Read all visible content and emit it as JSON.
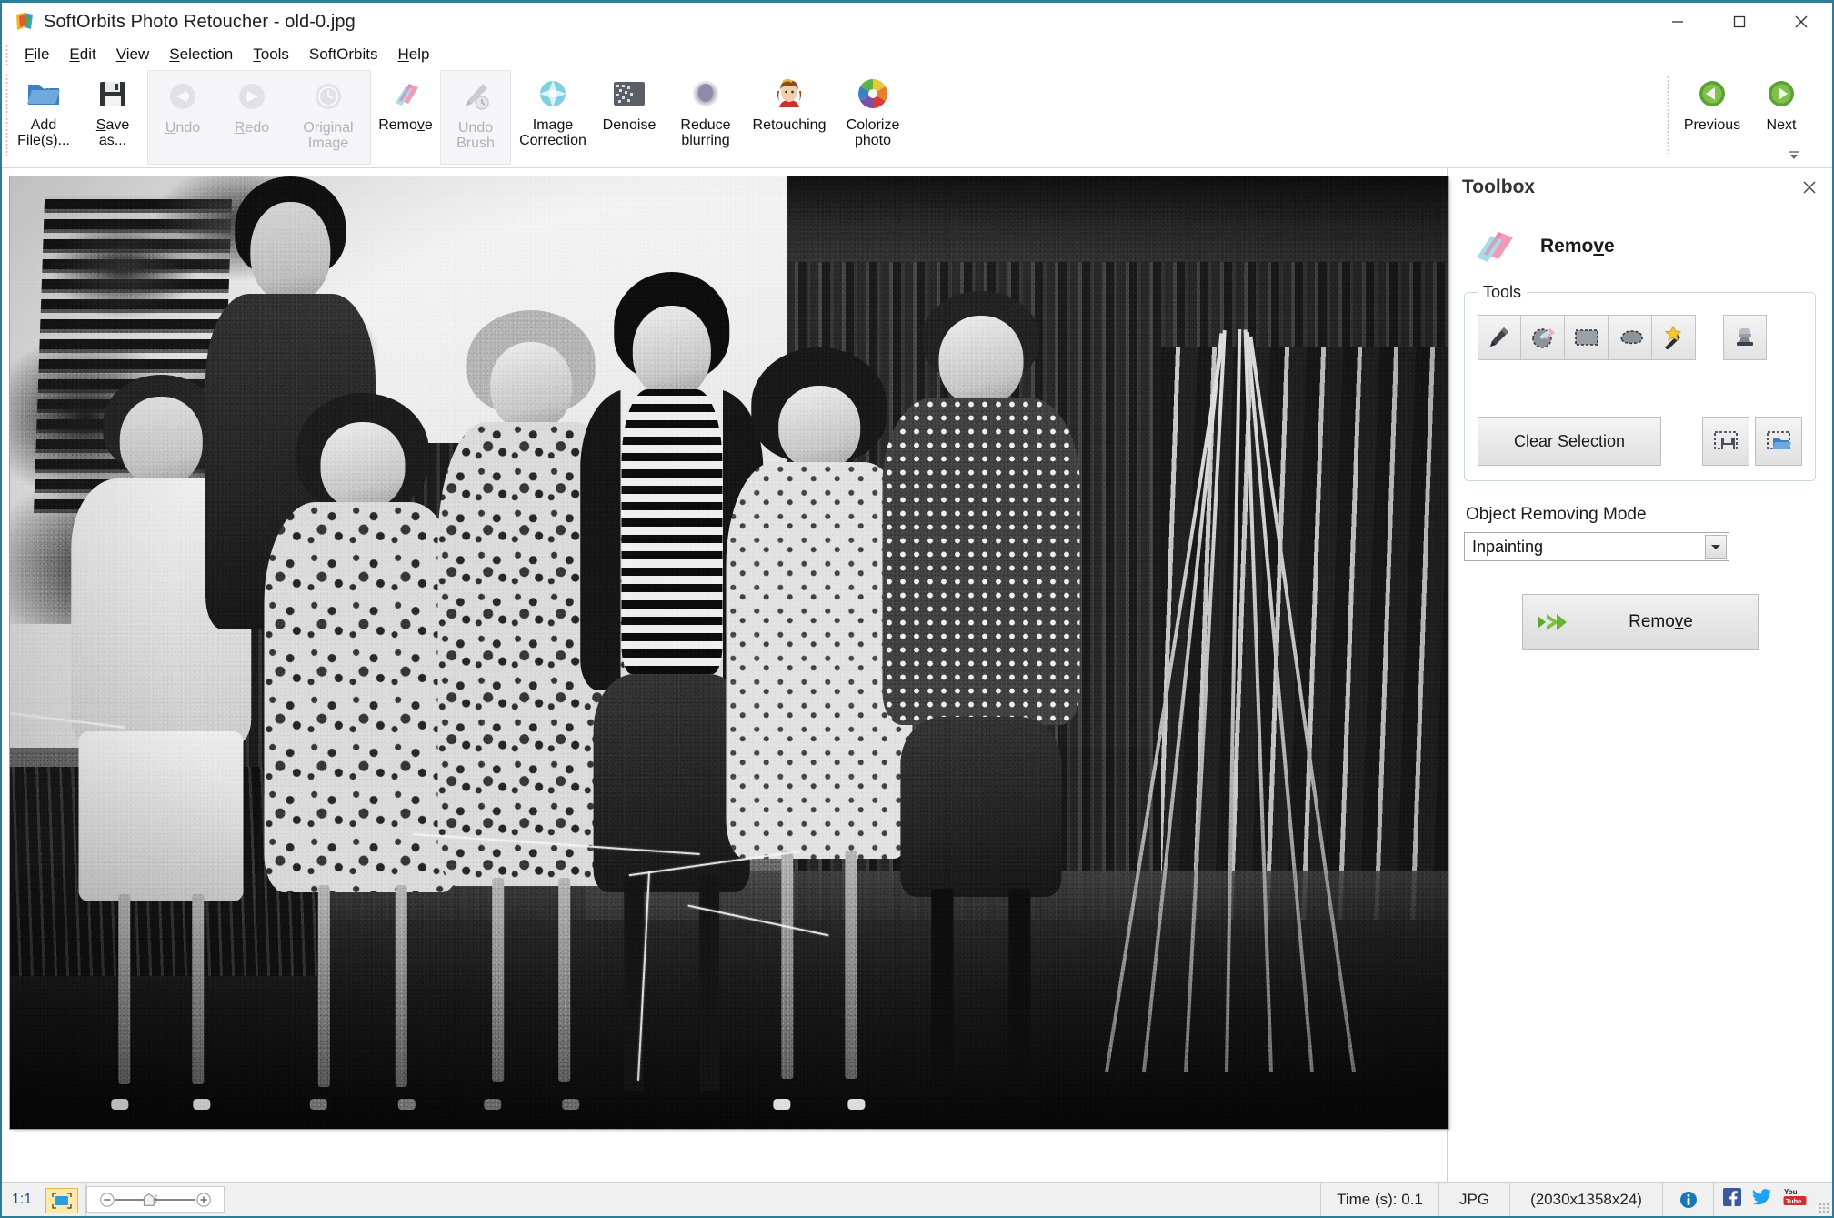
{
  "window": {
    "title": "SoftOrbits Photo Retoucher - old-0.jpg",
    "app_icon": "softorbits-logo-icon",
    "minimize": "minimize-icon",
    "maximize": "maximize-icon",
    "close": "close-icon",
    "accent_color": "#2e7d96"
  },
  "menubar": {
    "items": [
      {
        "label": "File",
        "accel": "F"
      },
      {
        "label": "Edit",
        "accel": "E"
      },
      {
        "label": "View",
        "accel": "V"
      },
      {
        "label": "Selection",
        "accel": "S"
      },
      {
        "label": "Tools",
        "accel": "T"
      },
      {
        "label": "SoftOrbits",
        "accel": ""
      },
      {
        "label": "Help",
        "accel": "H"
      }
    ]
  },
  "ribbon": {
    "buttons": [
      {
        "label_line1": "Add",
        "label_line2": "File(s)...",
        "icon": "open-folder-icon",
        "enabled": true,
        "accel": "l"
      },
      {
        "label_line1": "Save",
        "label_line2": "as...",
        "icon": "floppy-disk-icon",
        "enabled": true,
        "accel": "S"
      },
      {
        "label_line1": "Undo",
        "label_line2": "",
        "icon": "arrow-left-circle-icon",
        "enabled": false,
        "accel": "U"
      },
      {
        "label_line1": "Redo",
        "label_line2": "",
        "icon": "arrow-right-circle-icon",
        "enabled": false,
        "accel": "R"
      },
      {
        "label_line1": "Original",
        "label_line2": "Image",
        "icon": "clock-history-icon",
        "enabled": false,
        "accel": ""
      },
      {
        "label_line1": "Remove",
        "label_line2": "",
        "icon": "eraser-icon",
        "enabled": true,
        "accel": "v"
      },
      {
        "label_line1": "Undo",
        "label_line2": "Brush",
        "icon": "brush-history-icon",
        "enabled": false,
        "accel": ""
      },
      {
        "label_line1": "Image",
        "label_line2": "Correction",
        "icon": "sparkle-star-icon",
        "enabled": true,
        "accel": ""
      },
      {
        "label_line1": "Denoise",
        "label_line2": "",
        "icon": "noise-grid-icon",
        "enabled": true,
        "accel": ""
      },
      {
        "label_line1": "Reduce",
        "label_line2": "blurring",
        "icon": "blur-circle-icon",
        "enabled": true,
        "accel": ""
      },
      {
        "label_line1": "Retouching",
        "label_line2": "",
        "icon": "portrait-face-icon",
        "enabled": true,
        "accel": ""
      },
      {
        "label_line1": "Colorize",
        "label_line2": "photo",
        "icon": "color-wheel-icon",
        "enabled": true,
        "accel": ""
      }
    ],
    "navigation": [
      {
        "label": "Previous",
        "icon": "green-arrow-left-icon"
      },
      {
        "label": "Next",
        "icon": "green-arrow-right-icon"
      }
    ],
    "expand_icon": "ribbon-expand-icon"
  },
  "toolbox": {
    "panel_title": "Toolbox",
    "close_icon": "close-icon",
    "mode_icon": "eraser-icon",
    "mode_title": "Remove",
    "mode_title_accel": "v",
    "tools_group_legend": "Tools",
    "tools": [
      {
        "name": "pencil-tool",
        "icon": "pencil-icon"
      },
      {
        "name": "eraser-tool",
        "icon": "eraser-circle-icon"
      },
      {
        "name": "rectangle-select-tool",
        "icon": "rectangle-marquee-icon"
      },
      {
        "name": "lasso-tool",
        "icon": "lasso-icon"
      },
      {
        "name": "magic-wand-tool",
        "icon": "magic-wand-icon"
      },
      {
        "name": "clone-stamp-tool",
        "icon": "stamp-icon"
      }
    ],
    "clear_selection": "Clear Selection",
    "clear_selection_accel": "C",
    "save_selection_icon": "save-selection-icon",
    "load_selection_icon": "load-selection-icon",
    "mode_label": "Object Removing Mode",
    "mode_value": "Inpainting",
    "mode_options": [
      "Inpainting"
    ],
    "dropdown_icon": "chevron-down-icon",
    "action_button_label": "Remove",
    "action_button_accel": "v",
    "action_button_icon": "green-double-arrow-icon"
  },
  "statusbar": {
    "zoom_ratio": "1:1",
    "fit_icon": "fit-to-screen-icon",
    "zoom_out_icon": "minus-circle-icon",
    "zoom_in_icon": "plus-circle-icon",
    "zoom_handle_icon": "slider-handle-icon",
    "time": "Time (s): 0.1",
    "format": "JPG",
    "dimensions": "(2030x1358x24)",
    "info_icon": "info-icon",
    "facebook_icon": "facebook-icon",
    "twitter_icon": "twitter-icon",
    "youtube_icon": "youtube-icon",
    "resize_grip": "resize-grip-icon"
  },
  "photo": {
    "description": "Vintage black-and-white group photograph of seven people standing in front of a wooden barn",
    "filename": "old-0.jpg"
  }
}
